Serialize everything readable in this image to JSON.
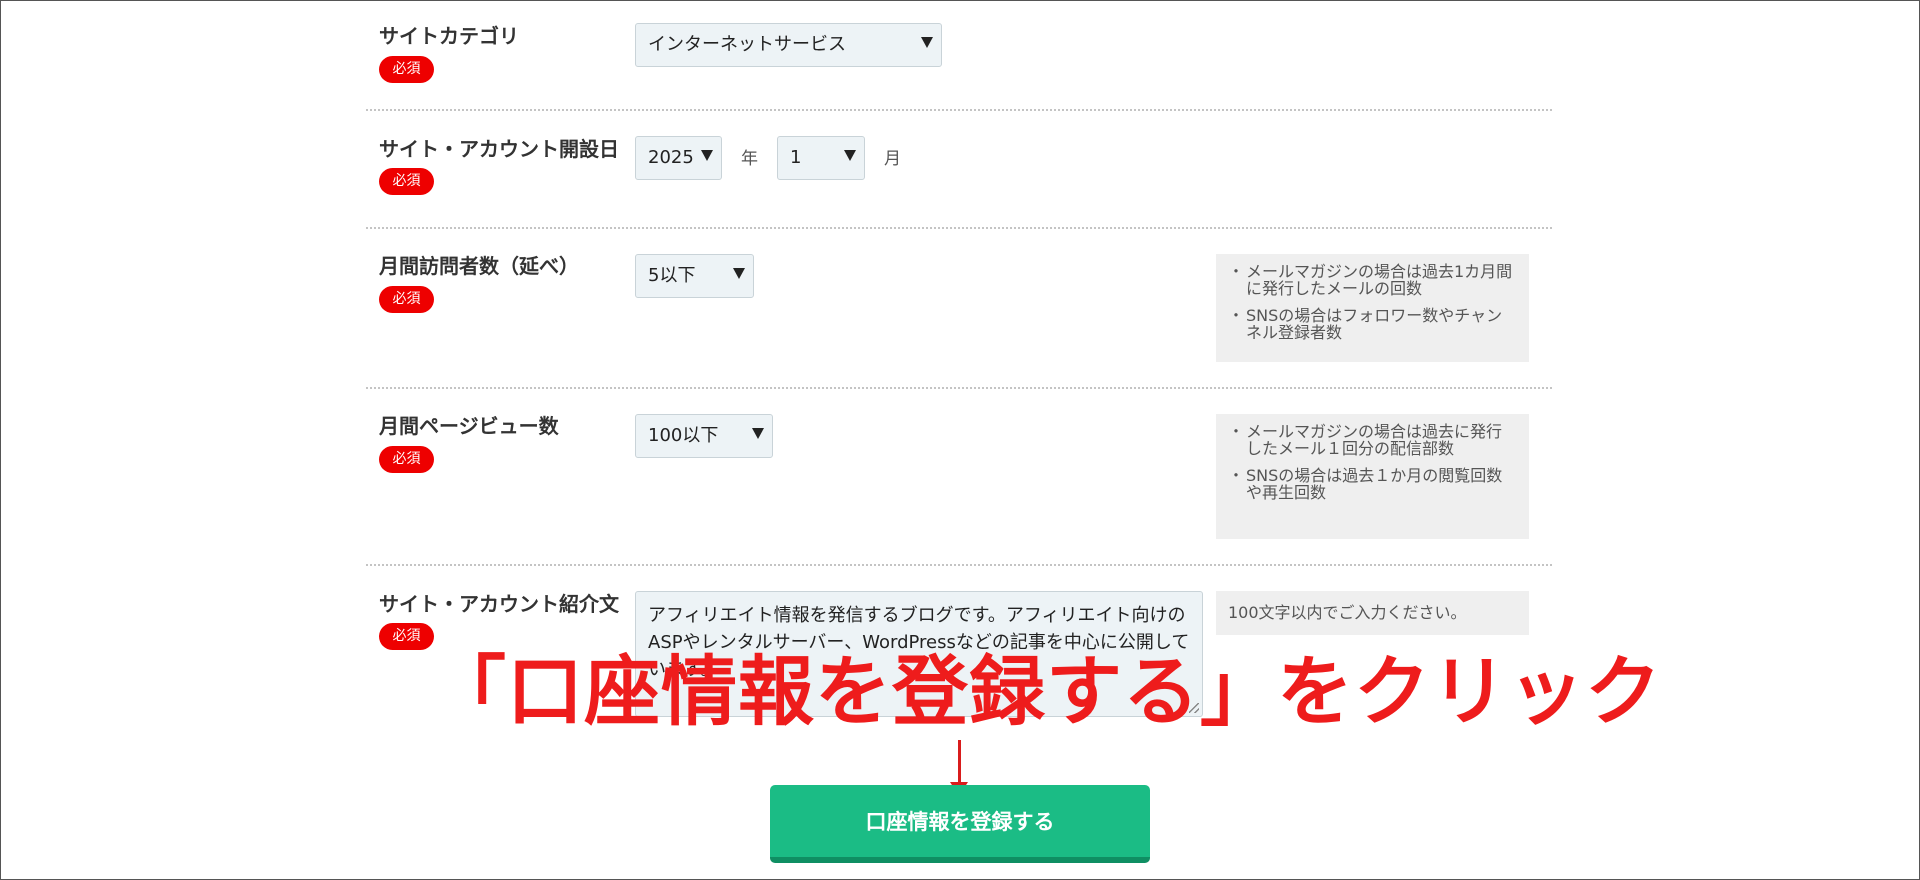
{
  "required_label": "必須",
  "fields": {
    "category": {
      "label": "サイトカテゴリ",
      "value": "インターネットサービス"
    },
    "opening_date": {
      "label": "サイト・アカウント開設日",
      "year": "2025",
      "year_unit": "年",
      "month": "1",
      "month_unit": "月"
    },
    "monthly_visitors": {
      "label": "月間訪問者数（延べ）",
      "value": "5以下",
      "notes": [
        "メールマガジンの場合は過去1カ月間に発行したメールの回数",
        "SNSの場合はフォロワー数やチャンネル登録者数"
      ]
    },
    "monthly_pageviews": {
      "label": "月間ページビュー数",
      "value": "100以下",
      "notes": [
        "メールマガジンの場合は過去に発行したメール１回分の配信部数",
        "SNSの場合は過去１か月の閲覧回数や再生回数"
      ]
    },
    "description": {
      "label": "サイト・アカウント紹介文",
      "value": "アフィリエイト情報を発信するブログです。アフィリエイト向けのASPやレンタルサーバー、WordPressなどの記事を中心に公開しています。",
      "hint": "100文字以内でご入力ください。"
    }
  },
  "annotation": "「口座情報を登録する」をクリック",
  "submit_label": "口座情報を登録する",
  "colors": {
    "required_badge": "#ee0000",
    "annotation": "#ee1c1c",
    "submit_button": "#1bbc85"
  }
}
